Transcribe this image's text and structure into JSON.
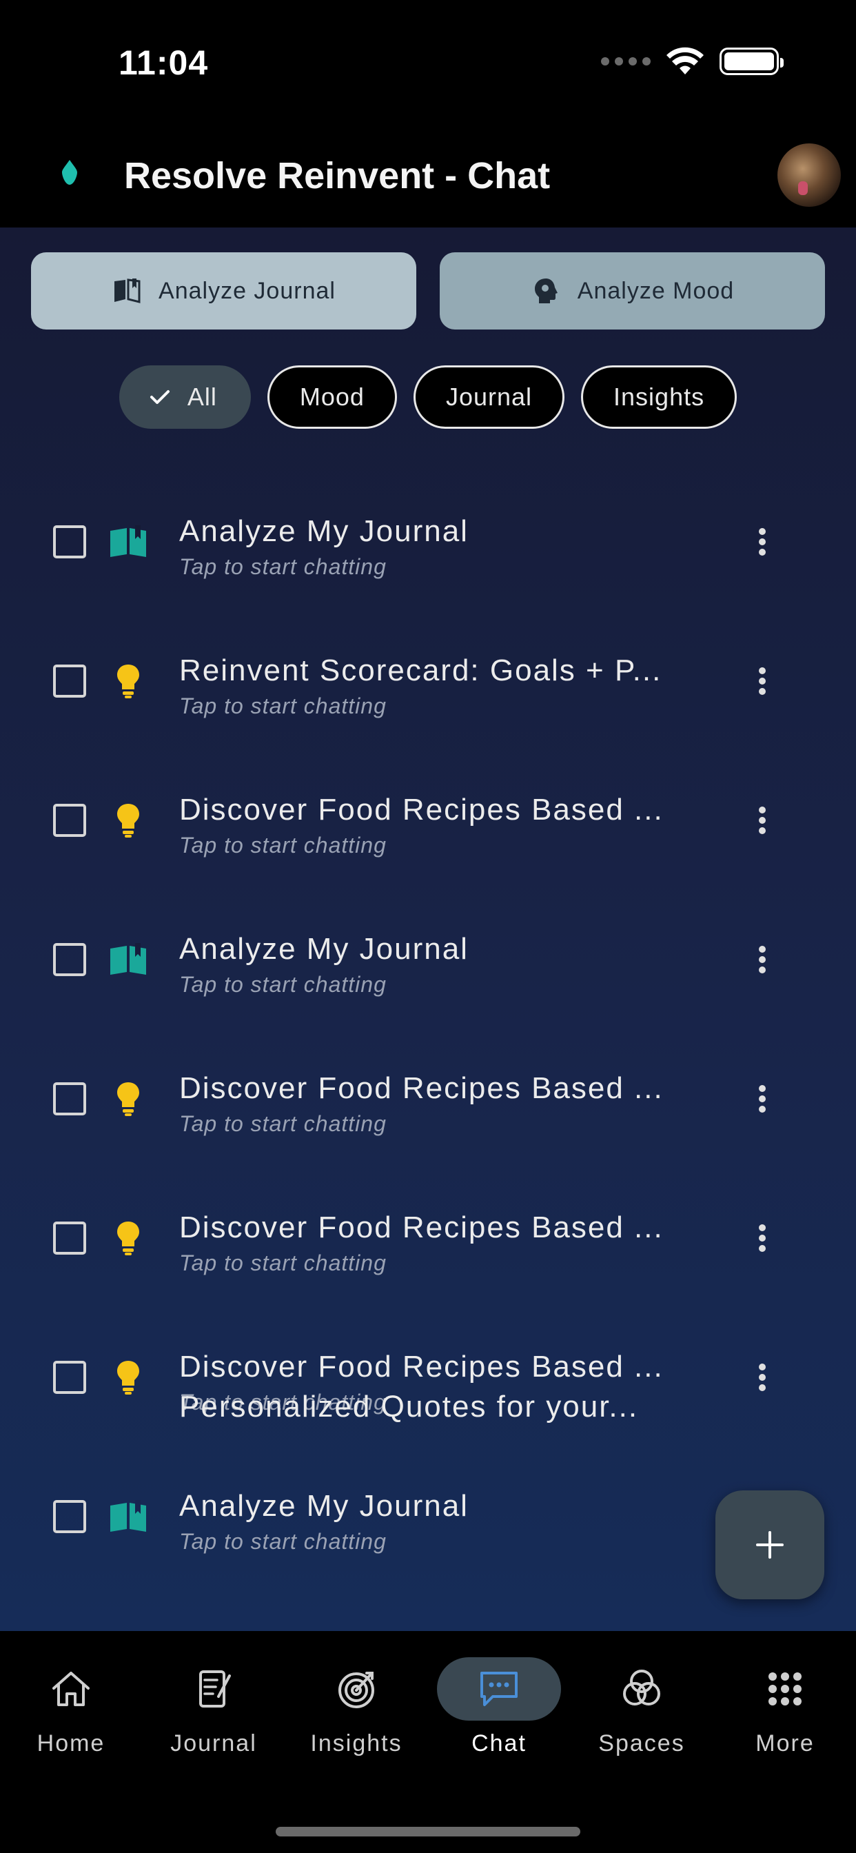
{
  "status_bar": {
    "time": "11:04"
  },
  "header": {
    "title": "Resolve Reinvent - Chat"
  },
  "actions": {
    "analyze_journal": "Analyze Journal",
    "analyze_mood": "Analyze Mood"
  },
  "filters": [
    {
      "label": "All",
      "selected": true
    },
    {
      "label": "Mood",
      "selected": false
    },
    {
      "label": "Journal",
      "selected": false
    },
    {
      "label": "Insights",
      "selected": false
    }
  ],
  "chats": [
    {
      "title": "Analyze My Journal",
      "subtitle": "Tap to start chatting",
      "icon": "book-icon"
    },
    {
      "title": "Reinvent Scorecard: Goals + P...",
      "subtitle": "Tap to start chatting",
      "icon": "lightbulb-icon"
    },
    {
      "title": "Discover Food Recipes Based ...",
      "subtitle": "Tap to start chatting",
      "icon": "lightbulb-icon"
    },
    {
      "title": "Analyze My Journal",
      "subtitle": "Tap to start chatting",
      "icon": "book-icon"
    },
    {
      "title": "Discover Food Recipes Based ...",
      "subtitle": "Tap to start chatting",
      "icon": "lightbulb-icon"
    },
    {
      "title": "Discover Food Recipes Based ...",
      "subtitle": "Tap to start chatting",
      "icon": "lightbulb-icon"
    },
    {
      "title": "Discover Food Recipes Based ...",
      "subtitle": "Tap to start chatting",
      "icon": "lightbulb-icon"
    },
    {
      "title": "Analyze My Journal",
      "subtitle": "Tap to start chatting",
      "icon": "book-icon"
    }
  ],
  "partial_chat_title": "Personalized Quotes for your...",
  "nav": [
    {
      "label": "Home",
      "icon": "home-icon",
      "active": false
    },
    {
      "label": "Journal",
      "icon": "journal-icon",
      "active": false
    },
    {
      "label": "Insights",
      "icon": "target-icon",
      "active": false
    },
    {
      "label": "Chat",
      "icon": "chat-icon",
      "active": true
    },
    {
      "label": "Spaces",
      "icon": "spaces-icon",
      "active": false
    },
    {
      "label": "More",
      "icon": "grid-icon",
      "active": false
    }
  ],
  "colors": {
    "accent_teal": "#1fbfae",
    "book_icon": "#1aa89a",
    "lightbulb_icon": "#f6c417",
    "chat_active": "#4a8fd8"
  }
}
